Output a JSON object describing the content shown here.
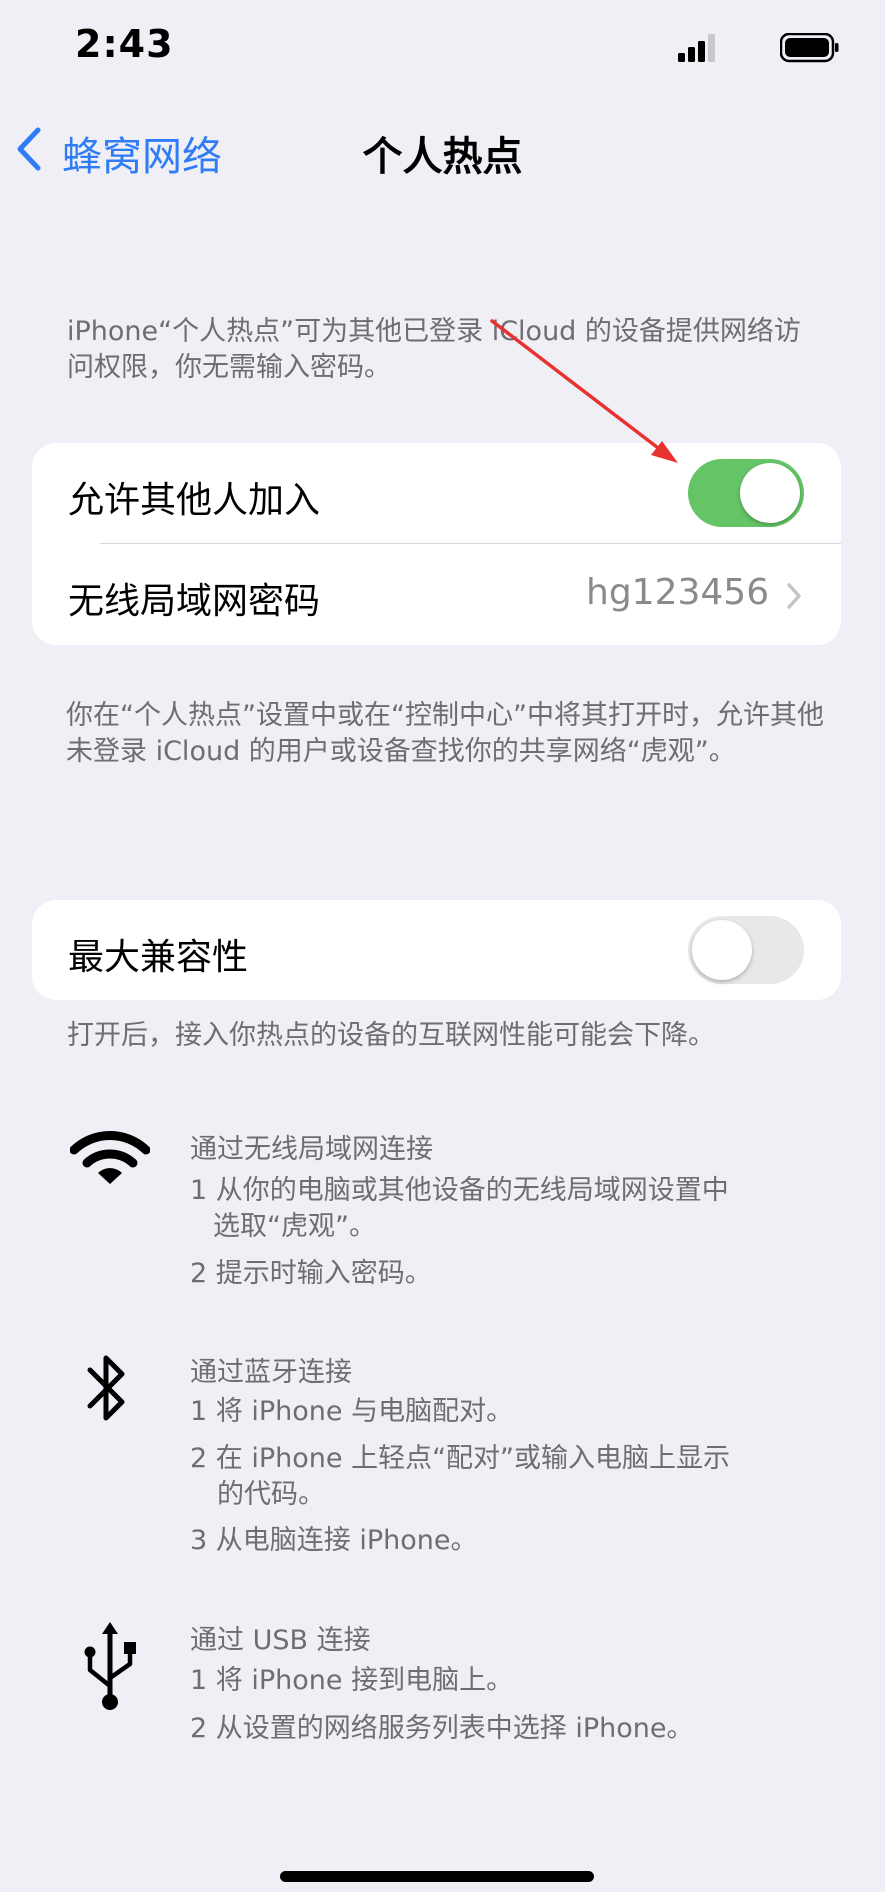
{
  "status_bar": {
    "time": "2:43"
  },
  "nav": {
    "back_label": "蜂窝网络",
    "title": "个人热点"
  },
  "intro_text": "iPhone“个人热点”可为其他已登录 iCloud 的设备提供网络访问权限，你无需输入密码。",
  "allow_others": {
    "label": "允许其他人加入",
    "enabled": true
  },
  "wifi_password": {
    "label": "无线局域网密码",
    "value": "hg123456"
  },
  "discover_text": "你在“个人热点”设置中或在“控制中心”中将其打开时，允许其他未登录 iCloud 的用户或设备查找你的共享网络“虎观”。",
  "max_compat": {
    "label": "最大兼容性",
    "enabled": false,
    "footer": "打开后，接入你热点的设备的互联网性能可能会下降。"
  },
  "connections": {
    "wifi": {
      "icon": "wifi-icon",
      "title": "通过无线局域网连接",
      "steps": [
        "1 从你的电脑或其他设备的无线局域网设置中",
        "选取“虎观”。",
        "2 提示时输入密码。"
      ]
    },
    "bluetooth": {
      "icon": "bluetooth-icon",
      "title": "通过蓝牙连接",
      "steps": [
        "1 将 iPhone 与电脑配对。",
        "2 在 iPhone 上轻点“配对”或输入电脑上显示",
        "的代码。",
        "3 从电脑连接 iPhone。"
      ]
    },
    "usb": {
      "icon": "usb-icon",
      "title": "通过 USB 连接",
      "steps": [
        "1 将 iPhone 接到电脑上。",
        "2 从设置的网络服务列表中选择 iPhone。"
      ]
    }
  },
  "colors": {
    "accent": "#2f7cf6",
    "toggle_on": "#65c466",
    "annotation_arrow": "#e8322f"
  }
}
